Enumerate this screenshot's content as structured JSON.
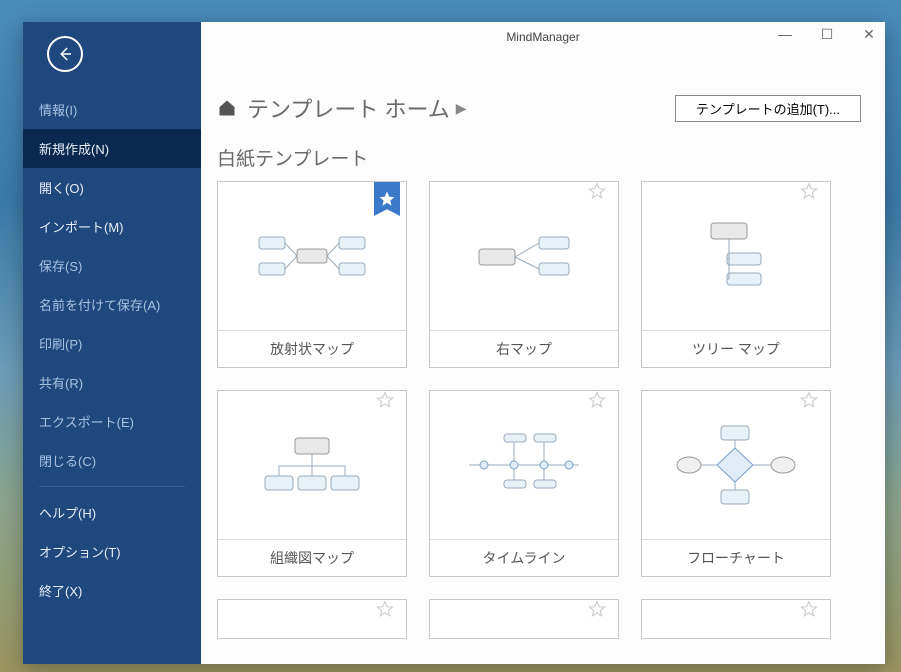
{
  "app_title": "MindManager",
  "sidebar": {
    "items": [
      {
        "label": "情報(I)",
        "active": false,
        "bright": false
      },
      {
        "label": "新規作成(N)",
        "active": true,
        "bright": true
      },
      {
        "label": "開く(O)",
        "active": false,
        "bright": true
      },
      {
        "label": "インポート(M)",
        "active": false,
        "bright": true
      },
      {
        "label": "保存(S)",
        "active": false,
        "bright": false
      },
      {
        "label": "名前を付けて保存(A)",
        "active": false,
        "bright": false
      },
      {
        "label": "印刷(P)",
        "active": false,
        "bright": false
      },
      {
        "label": "共有(R)",
        "active": false,
        "bright": false
      },
      {
        "label": "エクスポート(E)",
        "active": false,
        "bright": false
      },
      {
        "label": "閉じる(C)",
        "active": false,
        "bright": false
      }
    ],
    "footer": [
      {
        "label": "ヘルプ(H)"
      },
      {
        "label": "オプション(T)"
      },
      {
        "label": "終了(X)"
      }
    ]
  },
  "header": {
    "breadcrumb": "テンプレート ホーム",
    "add_button": "テンプレートの追加(T)..."
  },
  "section_title": "白紙テンプレート",
  "templates": [
    {
      "name": "放射状マップ",
      "favorite": true,
      "diagram": "radial"
    },
    {
      "name": "右マップ",
      "favorite": false,
      "diagram": "right"
    },
    {
      "name": "ツリー マップ",
      "favorite": false,
      "diagram": "tree"
    },
    {
      "name": "組織図マップ",
      "favorite": false,
      "diagram": "org"
    },
    {
      "name": "タイムライン",
      "favorite": false,
      "diagram": "timeline"
    },
    {
      "name": "フローチャート",
      "favorite": false,
      "diagram": "flowchart"
    }
  ]
}
